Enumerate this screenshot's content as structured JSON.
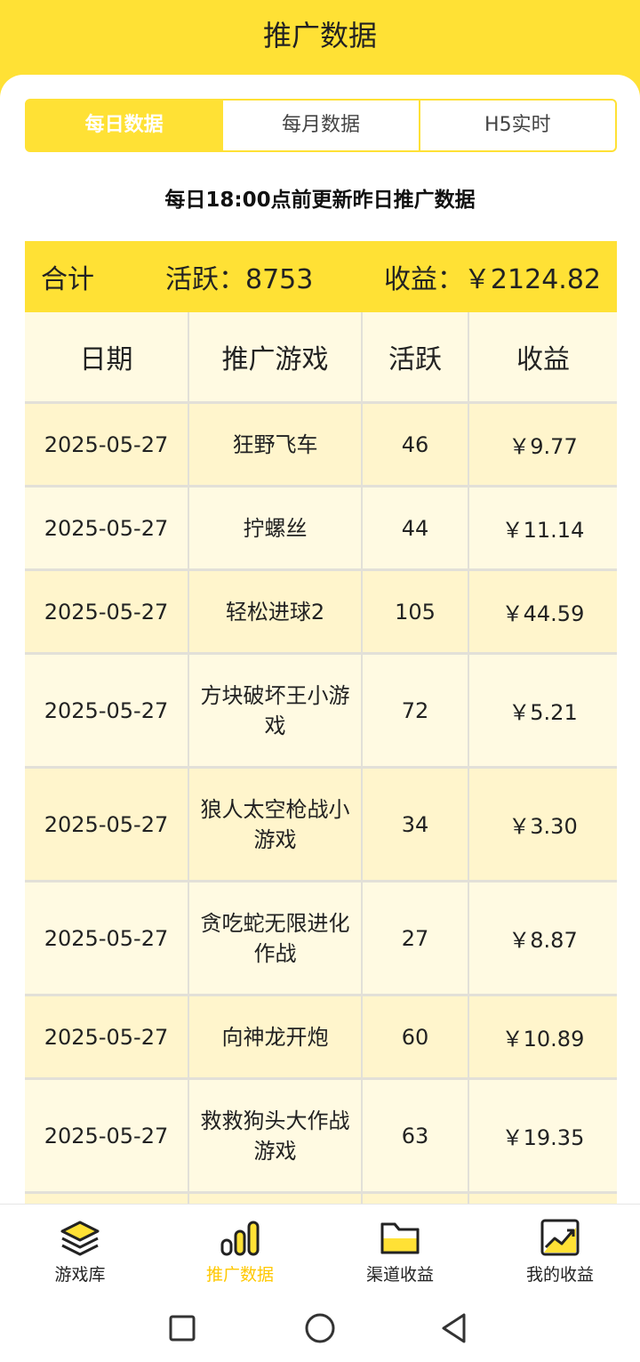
{
  "header": {
    "title": "推广数据"
  },
  "tabs": [
    {
      "label": "每日数据",
      "active": true
    },
    {
      "label": "每月数据",
      "active": false
    },
    {
      "label": "H5实时",
      "active": false
    }
  ],
  "notice": "每日18:00点前更新昨日推广数据",
  "summary": {
    "total_label": "合计",
    "active_text": "活跃：8753",
    "income_text": "收益：￥2124.82"
  },
  "table": {
    "headers": [
      "日期",
      "推广游戏",
      "活跃",
      "收益"
    ],
    "rows": [
      {
        "date": "2025-05-27",
        "game": "狂野飞车",
        "active": "46",
        "income": "￥9.77"
      },
      {
        "date": "2025-05-27",
        "game": "拧螺丝",
        "active": "44",
        "income": "￥11.14"
      },
      {
        "date": "2025-05-27",
        "game": "轻松进球2",
        "active": "105",
        "income": "￥44.59"
      },
      {
        "date": "2025-05-27",
        "game": "方块破坏王小游戏",
        "active": "72",
        "income": "￥5.21"
      },
      {
        "date": "2025-05-27",
        "game": "狼人太空枪战小游戏",
        "active": "34",
        "income": "￥3.30"
      },
      {
        "date": "2025-05-27",
        "game": "贪吃蛇无限进化作战",
        "active": "27",
        "income": "￥8.87"
      },
      {
        "date": "2025-05-27",
        "game": "向神龙开炮",
        "active": "60",
        "income": "￥10.89"
      },
      {
        "date": "2025-05-27",
        "game": "救救狗头大作战游戏",
        "active": "63",
        "income": "￥19.35"
      }
    ]
  },
  "bottom_nav": [
    {
      "label": "游戏库",
      "icon": "layers-icon",
      "active": false
    },
    {
      "label": "推广数据",
      "icon": "bar-chart-icon",
      "active": true
    },
    {
      "label": "渠道收益",
      "icon": "folder-icon",
      "active": false
    },
    {
      "label": "我的收益",
      "icon": "trend-chart-icon",
      "active": false
    }
  ],
  "colors": {
    "accent": "#ffe135",
    "active_nav": "#ffc800"
  }
}
